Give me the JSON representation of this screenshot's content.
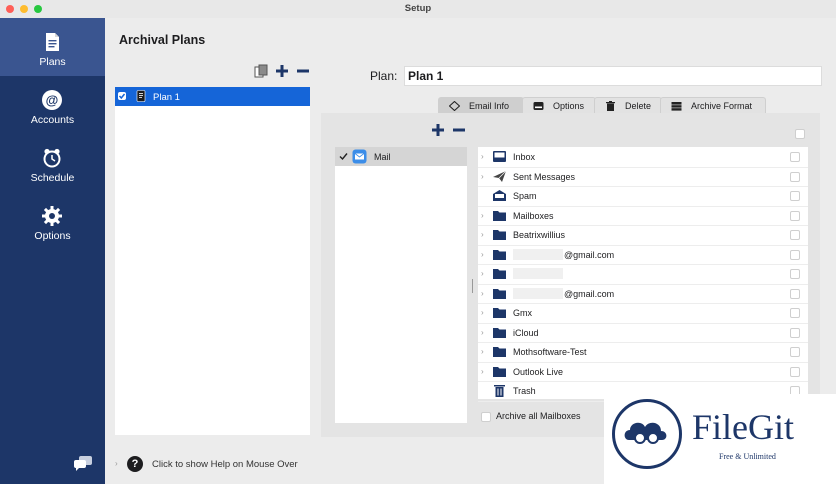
{
  "window": {
    "title": "Setup"
  },
  "sidebar": {
    "items": [
      {
        "label": "Plans",
        "icon": "document-icon",
        "active": true
      },
      {
        "label": "Accounts",
        "icon": "at-icon",
        "active": false
      },
      {
        "label": "Schedule",
        "icon": "clock-icon",
        "active": false
      },
      {
        "label": "Options",
        "icon": "gear-icon",
        "active": false
      }
    ]
  },
  "main": {
    "title": "Archival Plans",
    "plans": [
      {
        "name": "Plan 1",
        "checked": true
      }
    ],
    "plan_label": "Plan:",
    "plan_name": "Plan 1",
    "tabs": [
      {
        "label": "Email Info",
        "icon": "diamond-icon",
        "active": true
      },
      {
        "label": "Options",
        "icon": "drive-icon",
        "active": false
      },
      {
        "label": "Delete",
        "icon": "trash-icon",
        "active": false
      },
      {
        "label": "Archive Format",
        "icon": "archive-box-icon",
        "active": false
      }
    ],
    "accounts": [
      {
        "label": "Mail",
        "checked": true
      }
    ],
    "mailboxes": [
      {
        "label": "Inbox",
        "icon": "inbox-icon",
        "expandable": true
      },
      {
        "label": "Sent Messages",
        "icon": "paper-plane-icon",
        "expandable": true
      },
      {
        "label": "Spam",
        "icon": "spam-icon",
        "expandable": false
      },
      {
        "label": "Mailboxes",
        "icon": "folder-icon",
        "expandable": true
      },
      {
        "label": "Beatrixwillius",
        "icon": "folder-icon",
        "expandable": true
      },
      {
        "label": "@gmail.com",
        "icon": "folder-icon",
        "expandable": true,
        "redacted_prefix": true
      },
      {
        "label": "",
        "icon": "folder-icon",
        "expandable": true,
        "redacted_prefix": true
      },
      {
        "label": "@gmail.com",
        "icon": "folder-icon",
        "expandable": true,
        "redacted_prefix": true
      },
      {
        "label": "Gmx",
        "icon": "folder-icon",
        "expandable": true
      },
      {
        "label": "iCloud",
        "icon": "folder-icon",
        "expandable": true
      },
      {
        "label": "Mothsoftware-Test",
        "icon": "folder-icon",
        "expandable": true
      },
      {
        "label": "Outlook Live",
        "icon": "folder-icon",
        "expandable": true
      },
      {
        "label": "Trash",
        "icon": "trash-icon",
        "expandable": false
      }
    ],
    "archive_all_label": "Archive all Mailboxes",
    "help_text": "Click to show Help on Mouse Over"
  },
  "watermark": {
    "name": "FileGit",
    "tagline": "Free & Unlimited"
  },
  "colors": {
    "sidebar": "#1d3668",
    "sidebar_active": "#3a5590",
    "selection": "#1565d8",
    "icon_navy": "#1d3668"
  }
}
